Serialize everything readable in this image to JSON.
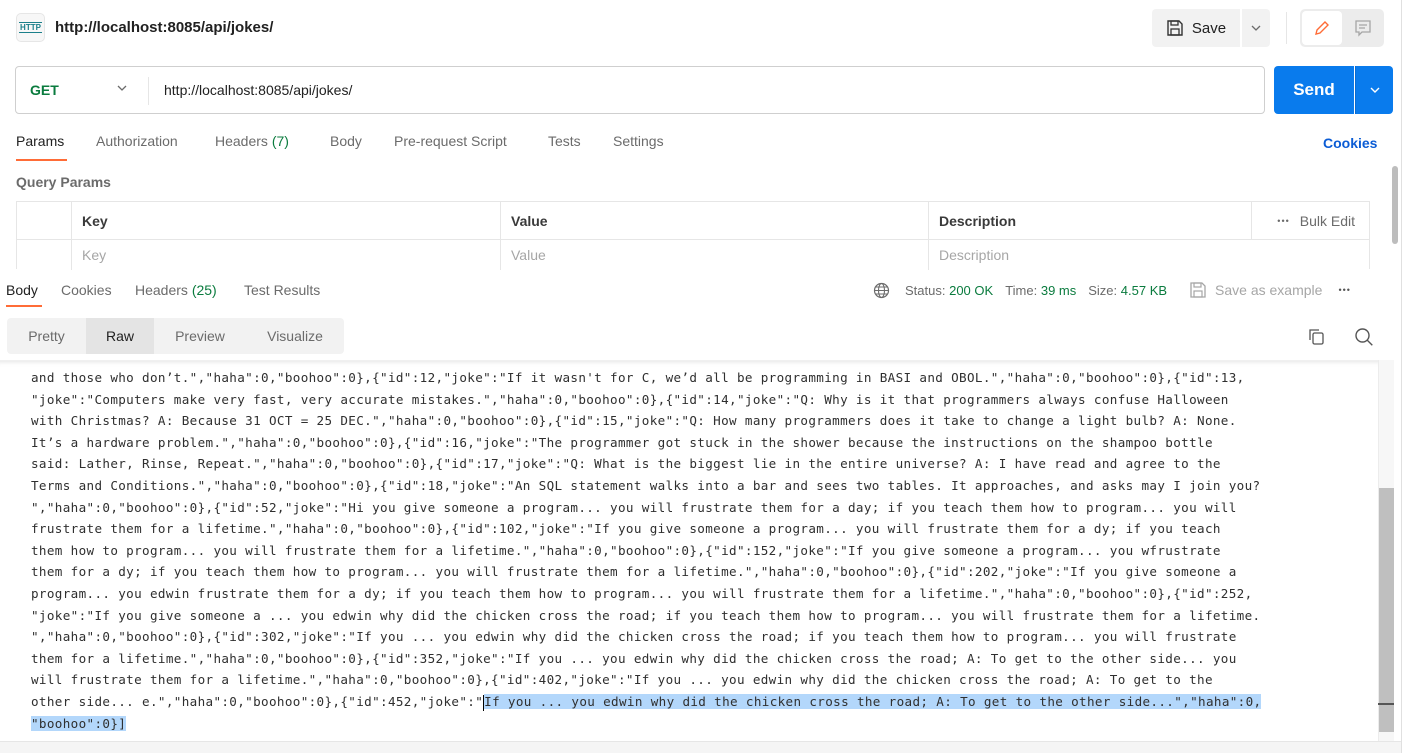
{
  "header": {
    "badge_text": "HTTP",
    "title": "http://localhost:8085/api/jokes/",
    "save_label": "Save",
    "icons": [
      "http-icon",
      "save-icon",
      "chevron-down-icon",
      "pencil-icon",
      "comment-icon"
    ]
  },
  "request": {
    "method": "GET",
    "url": "http://localhost:8085/api/jokes/",
    "send_label": "Send"
  },
  "request_tabs": [
    {
      "label": "Params",
      "active": true
    },
    {
      "label": "Authorization"
    },
    {
      "label": "Headers",
      "count": "(7)"
    },
    {
      "label": "Body"
    },
    {
      "label": "Pre-request Script"
    },
    {
      "label": "Tests"
    },
    {
      "label": "Settings"
    }
  ],
  "cookies_link": "Cookies",
  "query_params": {
    "title": "Query Params",
    "columns": [
      "Key",
      "Value",
      "Description"
    ],
    "placeholders": {
      "key": "Key",
      "value": "Value",
      "description": "Description"
    },
    "bulk_edit": "Bulk Edit",
    "more": "•••"
  },
  "response": {
    "tabs": [
      {
        "label": "Body",
        "active": true
      },
      {
        "label": "Cookies"
      },
      {
        "label": "Headers",
        "count": "(25)"
      },
      {
        "label": "Test Results"
      }
    ],
    "status_label": "Status:",
    "status_value": "200 OK",
    "time_label": "Time:",
    "time_value": "39 ms",
    "size_label": "Size:",
    "size_value": "4.57 KB",
    "save_example": "Save as example",
    "more": "•••",
    "view_modes": [
      {
        "label": "Pretty"
      },
      {
        "label": "Raw",
        "active": true
      },
      {
        "label": "Preview"
      },
      {
        "label": "Visualize"
      }
    ],
    "lines": [
      "and those who don’t.\",\"haha\":0,\"boohoo\":0},{\"id\":12,\"joke\":\"If it wasn't for C, we’d all be programming in BASI and OBOL.\",\"haha\":0,\"boohoo\":0},{\"id\":13,",
      "\"joke\":\"Computers make very fast, very accurate mistakes.\",\"haha\":0,\"boohoo\":0},{\"id\":14,\"joke\":\"Q: Why is it that programmers always confuse Halloween",
      "with Christmas? A: Because 31 OCT = 25 DEC.\",\"haha\":0,\"boohoo\":0},{\"id\":15,\"joke\":\"Q: How many programmers does it take to change a light bulb? A: None.",
      "It’s a hardware problem.\",\"haha\":0,\"boohoo\":0},{\"id\":16,\"joke\":\"The programmer got stuck in the shower because the instructions on the shampoo bottle",
      "said: Lather, Rinse, Repeat.\",\"haha\":0,\"boohoo\":0},{\"id\":17,\"joke\":\"Q: What is the biggest lie in the entire universe? A: I have read and agree to the",
      "Terms and Conditions.\",\"haha\":0,\"boohoo\":0},{\"id\":18,\"joke\":\"An SQL statement walks into a bar and sees two tables. It approaches, and asks may I join you?",
      "\",\"haha\":0,\"boohoo\":0},{\"id\":52,\"joke\":\"Hi you give someone a program... you will frustrate them for a day; if you teach them how to program... you will",
      "frustrate them for a lifetime.\",\"haha\":0,\"boohoo\":0},{\"id\":102,\"joke\":\"If you give someone a program... you will frustrate them for a dy; if you teach",
      "them how to program... you will frustrate them for a lifetime.\",\"haha\":0,\"boohoo\":0},{\"id\":152,\"joke\":\"If you give someone a program... you wfrustrate",
      "them for a dy; if you teach them how to program... you will frustrate them for a lifetime.\",\"haha\":0,\"boohoo\":0},{\"id\":202,\"joke\":\"If you give someone a",
      "program... you edwin frustrate them for a dy; if you teach them how to program... you will frustrate them for a lifetime.\",\"haha\":0,\"boohoo\":0},{\"id\":252,",
      "\"joke\":\"If you give someone a ... you edwin why did the chicken cross the road; if you teach them how to program... you will frustrate them for a lifetime.",
      "\",\"haha\":0,\"boohoo\":0},{\"id\":302,\"joke\":\"If you ... you edwin why did the chicken cross the road; if you teach them how to program... you will frustrate",
      "them for a lifetime.\",\"haha\":0,\"boohoo\":0},{\"id\":352,\"joke\":\"If you ... you edwin why did the chicken cross the road; A: To get to the other side... you",
      "will frustrate them for a lifetime.\",\"haha\":0,\"boohoo\":0},{\"id\":402,\"joke\":\"If you ... you edwin why did the chicken cross the road; A: To get to the"
    ],
    "line16_plain": "other side... e.\",\"haha\":0,\"boohoo\":0},{\"id\":452,\"joke\":\"",
    "line16_selected": "If you ... you edwin why did the chicken cross the road; A: To get to the other side...\",\"haha\":0,",
    "line17_selected": "\"boohoo\":0}]"
  },
  "colors": {
    "accent_orange": "#ff6c37",
    "send_blue": "#097bed",
    "method_green": "#0a7b3e",
    "link_blue": "#0b5cd5",
    "selection": "#b3d7fb"
  }
}
